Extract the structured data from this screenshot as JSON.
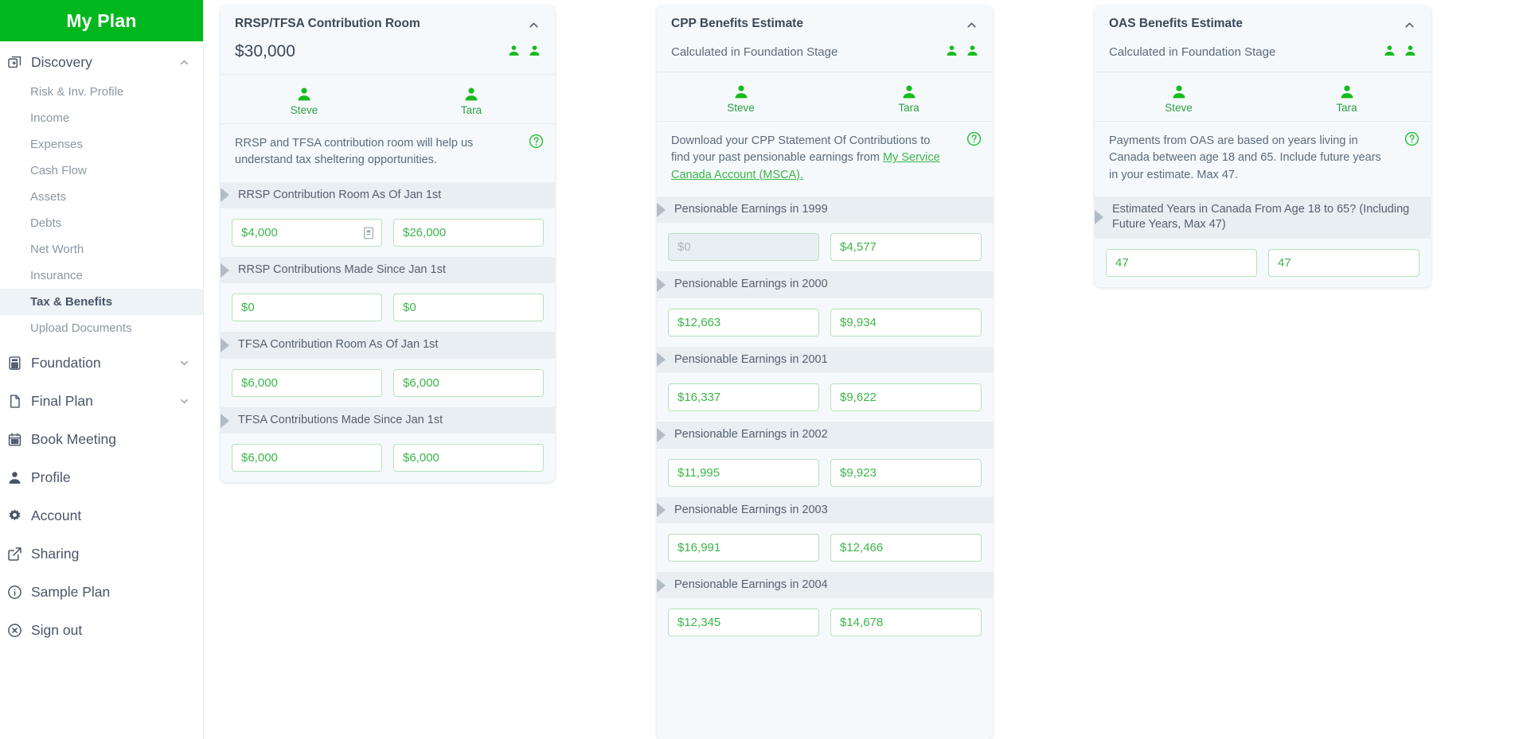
{
  "sidebar": {
    "brand": "My Plan",
    "groups": [
      {
        "label": "Discovery",
        "icon": "discovery-icon",
        "chevron": "chevron-up-icon",
        "items": [
          {
            "label": "Risk & Inv. Profile",
            "active": false
          },
          {
            "label": "Income",
            "active": false
          },
          {
            "label": "Expenses",
            "active": false
          },
          {
            "label": "Cash Flow",
            "active": false
          },
          {
            "label": "Assets",
            "active": false
          },
          {
            "label": "Debts",
            "active": false
          },
          {
            "label": "Net Worth",
            "active": false
          },
          {
            "label": "Insurance",
            "active": false
          },
          {
            "label": "Tax & Benefits",
            "active": true
          },
          {
            "label": "Upload Documents",
            "active": false
          }
        ]
      },
      {
        "label": "Foundation",
        "icon": "calculator-icon",
        "chevron": "chevron-down-icon",
        "items": []
      },
      {
        "label": "Final Plan",
        "icon": "document-icon",
        "chevron": "chevron-down-icon",
        "items": []
      },
      {
        "label": "Book Meeting",
        "icon": "calendar-icon",
        "chevron": "",
        "items": []
      },
      {
        "label": "Profile",
        "icon": "person-icon",
        "chevron": "",
        "items": []
      },
      {
        "label": "Account",
        "icon": "gear-icon",
        "chevron": "",
        "items": []
      },
      {
        "label": "Sharing",
        "icon": "external-link-icon",
        "chevron": "",
        "items": []
      },
      {
        "label": "Sample Plan",
        "icon": "info-icon",
        "chevron": "",
        "items": []
      },
      {
        "label": "Sign out",
        "icon": "sign-out-icon",
        "chevron": "",
        "items": []
      }
    ]
  },
  "colors": {
    "brand_green": "#00b81d",
    "accent_green": "#3cb54a",
    "card_bg": "#f5f9fc",
    "label_bg": "#e9eef2"
  },
  "cards": {
    "rrsp": {
      "title": "RRSP/TFSA Contribution Room",
      "subtitle": "$30,000",
      "owners": [
        "Steve",
        "Tara"
      ],
      "description": "RRSP and TFSA contribution room will help us understand tax sheltering opportunities.",
      "fields": [
        {
          "label": "RRSP Contribution Room As Of Jan 1st",
          "steve": "$4,000",
          "tara": "$26,000",
          "steve_icon": true
        },
        {
          "label": "RRSP Contributions Made Since Jan 1st",
          "steve": "$0",
          "tara": "$0",
          "steve_icon": false
        },
        {
          "label": "TFSA Contribution Room As Of Jan 1st",
          "steve": "$6,000",
          "tara": "$6,000",
          "steve_icon": false
        },
        {
          "label": "TFSA Contributions Made Since Jan 1st",
          "steve": "$6,000",
          "tara": "$6,000",
          "steve_icon": false
        }
      ]
    },
    "cpp": {
      "title": "CPP Benefits Estimate",
      "subtitle": "Calculated in Foundation Stage",
      "owners": [
        "Steve",
        "Tara"
      ],
      "description_before": "Download your CPP Statement Of Contributions to find your past pensionable earnings from ",
      "description_link": "My Service Canada Account (MSCA).",
      "fields": [
        {
          "label": "Pensionable Earnings in 1999",
          "steve": "$0",
          "steve_disabled": true,
          "tara": "$4,577"
        },
        {
          "label": "Pensionable Earnings in 2000",
          "steve": "$12,663",
          "steve_disabled": false,
          "tara": "$9,934"
        },
        {
          "label": "Pensionable Earnings in 2001",
          "steve": "$16,337",
          "steve_disabled": false,
          "tara": "$9,622"
        },
        {
          "label": "Pensionable Earnings in 2002",
          "steve": "$11,995",
          "steve_disabled": false,
          "tara": "$9,923"
        },
        {
          "label": "Pensionable Earnings in 2003",
          "steve": "$16,991",
          "steve_disabled": false,
          "tara": "$12,466"
        },
        {
          "label": "Pensionable Earnings in 2004",
          "steve": "$12,345",
          "steve_disabled": false,
          "tara": "$14,678"
        }
      ]
    },
    "oas": {
      "title": "OAS Benefits Estimate",
      "subtitle": "Calculated in Foundation Stage",
      "owners": [
        "Steve",
        "Tara"
      ],
      "description": "Payments from OAS are based on years living in Canada between age 18 and 65. Include future years in your estimate. Max 47.",
      "fields": [
        {
          "label": "Estimated Years in Canada From Age 18 to 65? (Including Future Years, Max 47)",
          "steve": "47",
          "tara": "47"
        }
      ]
    }
  }
}
